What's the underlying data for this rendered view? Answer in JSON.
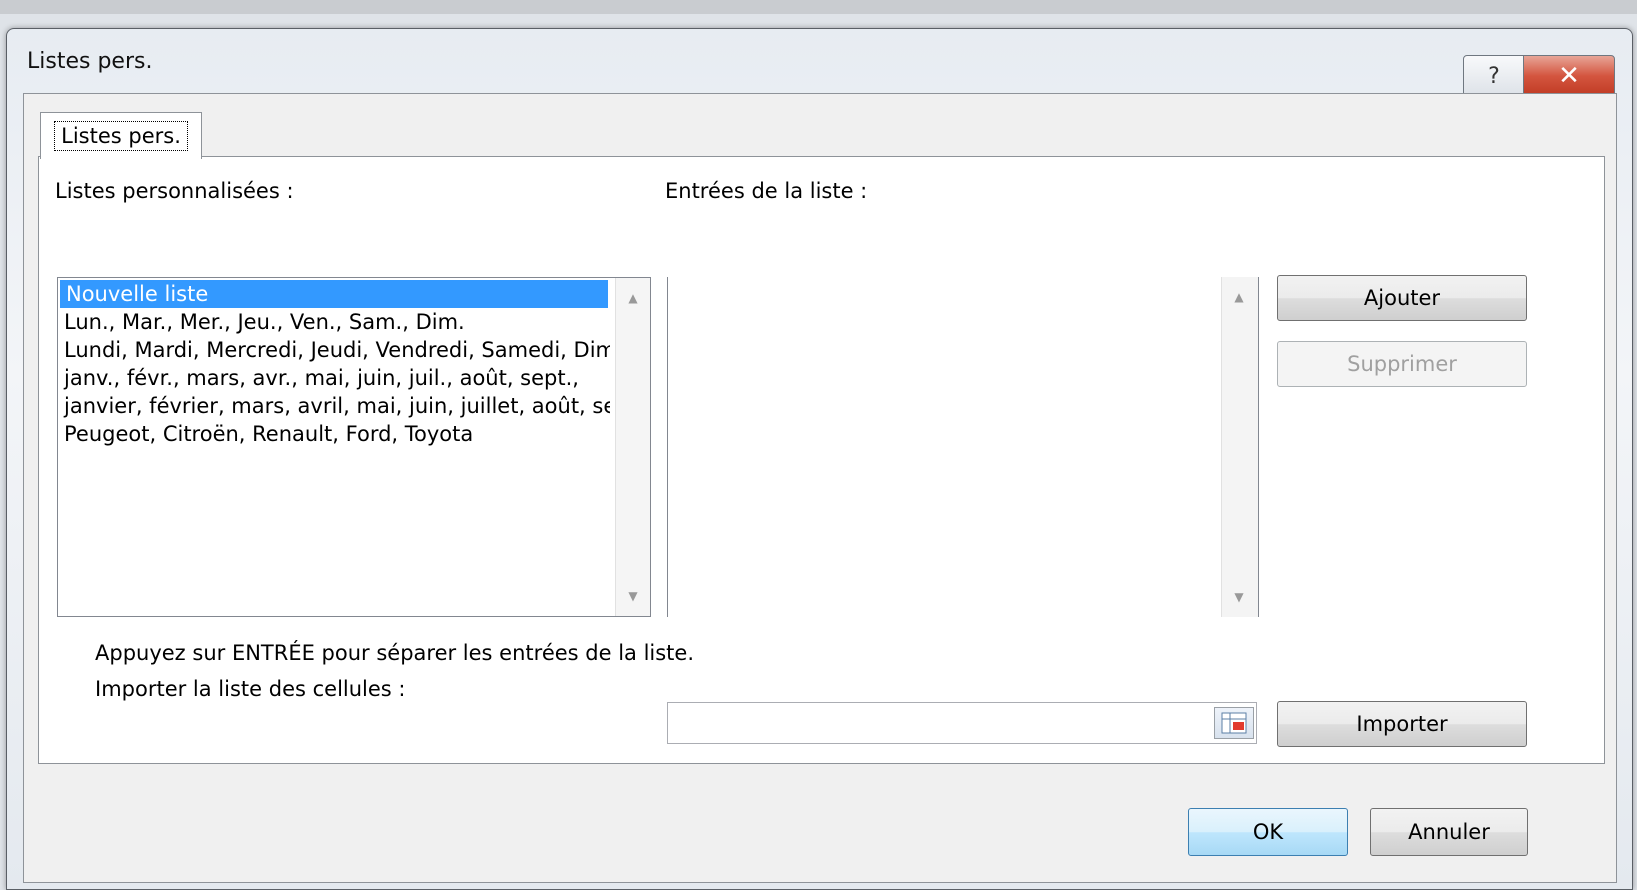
{
  "window": {
    "title": "Listes pers.",
    "help_label": "?",
    "close_label": "✕"
  },
  "tab": {
    "label": "Listes pers."
  },
  "custom_lists": {
    "label": "Listes personnalisées :",
    "items": [
      "Nouvelle liste",
      "Lun., Mar., Mer., Jeu., Ven., Sam., Dim.",
      "Lundi, Mardi, Mercredi, Jeudi, Vendredi, Samedi, Dim",
      "janv., févr., mars, avr., mai, juin, juil., août, sept.,",
      "janvier, février, mars, avril, mai, juin, juillet, août, se",
      "Peugeot, Citroën, Renault, Ford, Toyota"
    ],
    "selected_index": 0
  },
  "list_entries": {
    "label": "Entrées de la liste :",
    "value": ""
  },
  "buttons": {
    "add": "Ajouter",
    "delete": "Supprimer",
    "import": "Importer",
    "ok": "OK",
    "cancel": "Annuler"
  },
  "hint": "Appuyez sur ENTRÉE pour séparer les entrées de la liste.",
  "import_label": "Importer la liste des cellules :",
  "import_value": "",
  "icons": {
    "up": "▲",
    "down": "▼",
    "range_picker": "range-select-icon"
  },
  "colors": {
    "selection": "#3399ff",
    "close_button": "#c9442c"
  }
}
